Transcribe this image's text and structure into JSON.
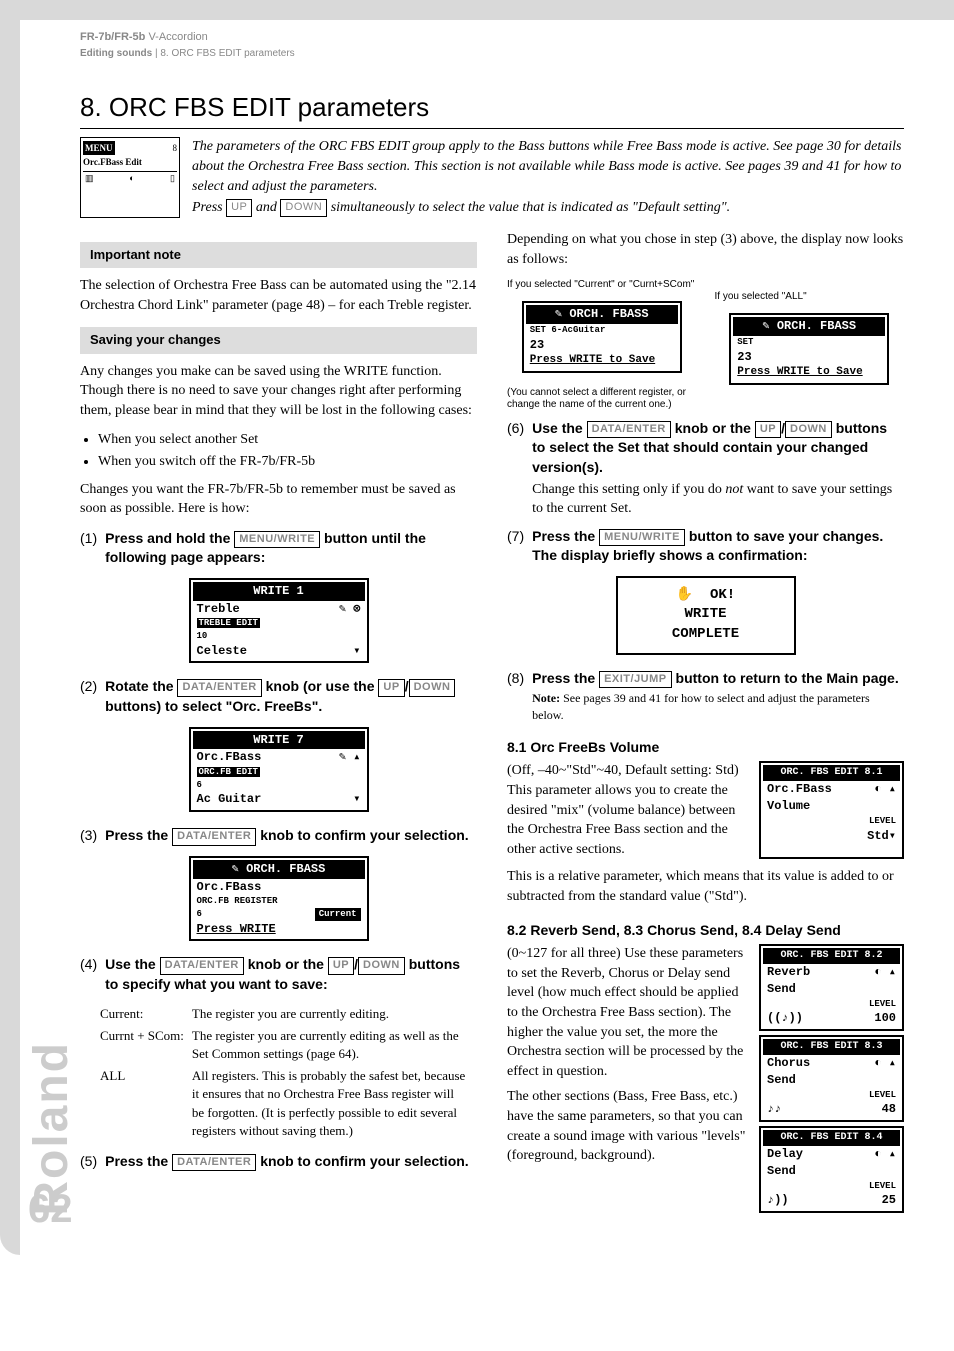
{
  "header": {
    "model": "FR-7b/FR-5b",
    "product": "V-Accordion",
    "breadcrumb_bold": "Editing sounds",
    "breadcrumb_rest": " | 8. ORC FBS EDIT parameters"
  },
  "title": "8. ORC FBS EDIT parameters",
  "menu_icon": {
    "top": "MENU",
    "num": "8",
    "line": "Orc.FBass Edit"
  },
  "intro": {
    "p1": "The parameters of the ORC FBS EDIT group apply to the Bass buttons while Free Bass mode is active. See page 30 for details about the Orchestra Free Bass section. This section is not available while Bass mode is active. See pages 39 and 41 for how to select and adjust the parameters.",
    "p2a": "Press ",
    "k1": "UP",
    "p2b": " and ",
    "k2": "DOWN",
    "p2c": " simultaneously to select the value that is indicated as \"Default setting\"."
  },
  "col1": {
    "note1_h": "Important note",
    "note1_p": "The selection of Orchestra Free Bass can be automated using the \"2.14 Orchestra Chord Link\" parameter (page 48) – for each Treble register.",
    "note2_h": "Saving your changes",
    "note2_p": "Any changes you make can be saved using the WRITE function. Though there is no need to save your changes right after performing them, please bear in mind that they will be lost in the following cases:",
    "bul1": "When you select another Set",
    "bul2": "When you switch off the FR-7b/FR-5b",
    "note2_p2": "Changes you want the FR-7b/FR-5b to remember must be saved as soon as possible. Here is how:",
    "s1a": "Press and hold the ",
    "s1k": "MENU/WRITE",
    "s1b": " button until the following page appears:",
    "lcd1": {
      "title": "WRITE          1",
      "r1a": "Treble",
      "sub": "TREBLE EDIT",
      "sub2": "10",
      "r2": "Celeste"
    },
    "s2a": "Rotate the ",
    "s2k1": "DATA/ENTER",
    "s2b": " knob (or use the ",
    "s2k2": "UP",
    "s2c": "/",
    "s2k3": "DOWN",
    "s2d": " buttons) to select \"Orc. FreeBs\".",
    "lcd2": {
      "title": "WRITE          7",
      "r1": "Orc.FBass",
      "sub": "ORC.FB EDIT",
      "sub2": "6",
      "r2": "Ac Guitar"
    },
    "s3a": "Press the ",
    "s3k": "DATA/ENTER",
    "s3b": " knob to confirm your selection.",
    "lcd3": {
      "title": "✎ ORCH. FBASS",
      "r1": "Orc.FBass",
      "sub": "ORC.FB       REGISTER",
      "sub2": "6             Current",
      "r2": "Press WRITE"
    },
    "s4a": "Use the ",
    "s4k1": "DATA/ENTER",
    "s4b": " knob or the ",
    "s4k2": "UP",
    "s4c": "/",
    "s4k3": "DOWN",
    "s4d": " buttons to specify what you want to save:",
    "save": [
      {
        "k": "Current:",
        "v": "The register you are currently editing."
      },
      {
        "k": "Currnt + SCom:",
        "v": "The register you are currently editing as well as the Set Common settings (page 64)."
      },
      {
        "k": "ALL",
        "v": "All registers. This is probably the safest bet, because it ensures that no Orchestra Free Bass register will be forgotten. (It is perfectly possible to edit several registers without saving them.)"
      }
    ],
    "s5a": "Press the ",
    "s5k": "DATA/ENTER",
    "s5b": " knob to confirm your selection."
  },
  "col2": {
    "lead": "Depending on what you chose in step (3) above, the display now looks as follows:",
    "capL": "If you selected \"Current\" or \"Curnt+SCom\"",
    "capR": "If you selected \"ALL\"",
    "lcdL": {
      "title": "✎ ORCH. FBASS",
      "r1": "SET    6-AcGuitar",
      "r2": "23",
      "foot": "Press WRITE to Save"
    },
    "lcdR": {
      "title": "✎ ORCH. FBASS",
      "r1": "SET",
      "r2": "23",
      "foot": "Press WRITE to Save"
    },
    "capL2": "(You cannot select a different register, or change the name of the current one.)",
    "s6a": "Use the ",
    "s6k1": "DATA/ENTER",
    "s6b": " knob or the ",
    "s6k2": "UP",
    "s6c": "/",
    "s6k3": "DOWN",
    "s6d": " buttons to select the Set that should contain your changed version(s).",
    "s6e_a": "Change this setting only if you do ",
    "s6e_i": "not",
    "s6e_b": " want to save your settings to the current Set.",
    "s7a": "Press the ",
    "s7k": "MENU/WRITE",
    "s7b": " button to save your changes. The display briefly shows a confirmation:",
    "lcdOK": {
      "r1": "OK!",
      "r2": "WRITE",
      "r3": "COMPLETE"
    },
    "s8a": "Press the ",
    "s8k": "EXIT/JUMP",
    "s8b": " button to return to the Main page.",
    "s8note": "Note: See pages 39 and 41 for how to select and adjust the parameters below.",
    "p81_h": "8.1 Orc FreeBs Volume",
    "p81_t": "(Off, –40~\"Std\"~40, Default setting: Std) This parameter allows you to create the desired \"mix\" (volume balance) between the Orchestra Free Bass section and the other active sections.",
    "p81_lcd": {
      "title": "ORC. FBS EDIT 8.1",
      "r1": "Orc.FBass",
      "r2": "Volume",
      "r3": "LEVEL",
      "r4": "Std"
    },
    "p81_t2": "This is a relative parameter, which means that its value is added to or subtracted from the standard value (\"Std\").",
    "p82_h": "8.2 Reverb Send, 8.3 Chorus Send, 8.4 Delay Send",
    "p82_t": "(0~127 for all three) Use these parameters to set the Reverb, Chorus or Delay send level (how much effect should be applied to the Orchestra Free Bass section). The higher the value you set, the more the Orchestra section will be processed by the effect in question.",
    "p82_t2": "The other sections (Bass, Free Bass, etc.) have the same parameters, so that you can create a sound image with various \"levels\" (foreground, background).",
    "lcd82": {
      "title": "ORC. FBS EDIT 8.2",
      "r1": "Reverb",
      "r2": "Send",
      "r3": "LEVEL",
      "r4": "100"
    },
    "lcd83": {
      "title": "ORC. FBS EDIT 8.3",
      "r1": "Chorus",
      "r2": "Send",
      "r3": "LEVEL",
      "r4": "48"
    },
    "lcd84": {
      "title": "ORC. FBS EDIT 8.4",
      "r1": "Delay",
      "r2": "Send",
      "r3": "LEVEL",
      "r4": "25"
    }
  },
  "brand": "Roland",
  "page": "62"
}
